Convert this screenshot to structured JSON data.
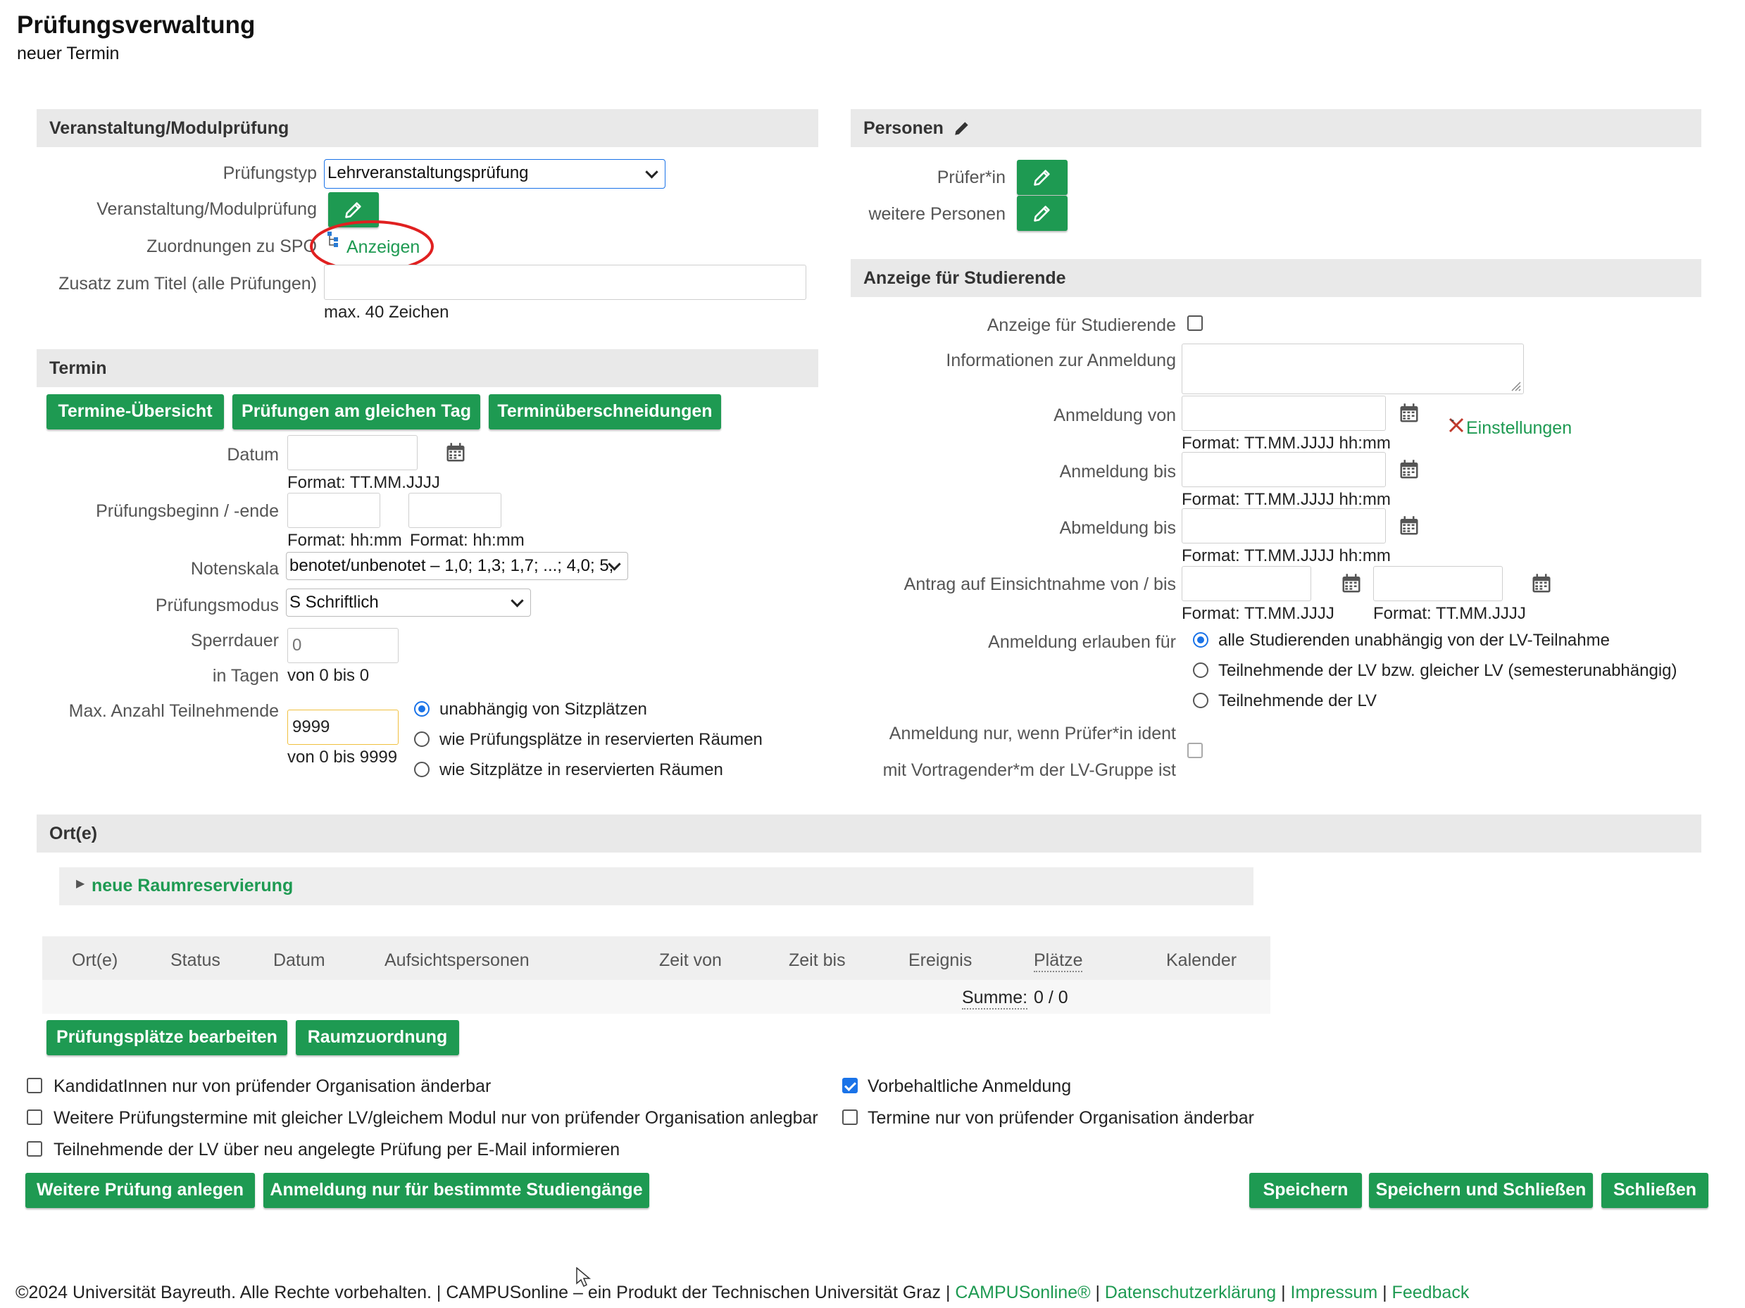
{
  "header": {
    "title": "Prüfungsverwaltung",
    "subtitle": "neuer Termin"
  },
  "veranstaltung": {
    "section_title": "Veranstaltung/Modulprüfung",
    "pruefungstyp_label": "Prüfungstyp",
    "pruefungstyp_value": "Lehrveranstaltungsprüfung",
    "veranstaltung_label": "Veranstaltung/Modulprüfung",
    "zuordnungen_label": "Zuordnungen zu SPO",
    "anzeigen_link": "Anzeigen",
    "zusatz_label": "Zusatz zum Titel (alle Prüfungen)",
    "zusatz_value": "",
    "zusatz_hint": "max. 40 Zeichen"
  },
  "termin": {
    "section_title": "Termin",
    "btn_uebersicht": "Termine-Übersicht",
    "btn_gleicher_tag": "Prüfungen am gleichen Tag",
    "btn_ueberschneidungen": "Terminüberschneidungen",
    "datum_label": "Datum",
    "datum_value": "",
    "datum_format": "Format: TT.MM.JJJJ",
    "beginn_label": "Prüfungsbeginn / -ende",
    "beginn_format": "Format: hh:mm",
    "ende_format": "Format: hh:mm",
    "notenskala_label": "Notenskala",
    "notenskala_value": "benotet/unbenotet – 1,0; 1,3; 1,7; ...; 4,0; 5,",
    "modus_label": "Prüfungsmodus",
    "modus_value": "S Schriftlich",
    "sperrdauer_label": "Sperrdauer",
    "sperrdauer_placeholder": "0",
    "in_tagen_label": "in Tagen",
    "sperrdauer_range": "von 0 bis 0",
    "max_label": "Max. Anzahl Teilnehmende",
    "max_value": "9999",
    "max_range": "von 0 bis 9999",
    "radio_1": "unabhängig von Sitzplätzen",
    "radio_2": "wie Prüfungsplätze in reservierten Räumen",
    "radio_3": "wie Sitzplätze in reservierten Räumen"
  },
  "personen": {
    "section_title": "Personen",
    "pruefer_label": "Prüfer*in",
    "weitere_label": "weitere Personen"
  },
  "anzeige": {
    "section_title": "Anzeige für Studierende",
    "anzeige_label": "Anzeige für Studierende",
    "info_label": "Informationen zur Anmeldung",
    "anmeldung_von_label": "Anmeldung von",
    "anmeldung_bis_label": "Anmeldung bis",
    "abmeldung_bis_label": "Abmeldung bis",
    "datetime_format": "Format: TT.MM.JJJJ hh:mm",
    "einstellungen_link": "Einstellungen",
    "antrag_label": "Antrag auf Einsichtnahme von / bis",
    "date_format": "Format: TT.MM.JJJJ",
    "erlauben_label": "Anmeldung erlauben für",
    "erlauben_1": "alle Studierenden unabhängig von der LV-Teilnahme",
    "erlauben_2": "Teilnehmende der LV bzw. gleicher LV (semesterunabhängig)",
    "erlauben_3": "Teilnehmende der LV",
    "ident_label_1": "Anmeldung nur, wenn Prüfer*in ident",
    "ident_label_2": "mit Vortragender*m der LV-Gruppe ist"
  },
  "orte": {
    "section_title": "Ort(e)",
    "neue_raum": "neue Raumreservierung",
    "columns": [
      "Ort(e)",
      "Status",
      "Datum",
      "Aufsichtspersonen",
      "Zeit von",
      "Zeit bis",
      "Ereignis",
      "Plätze",
      "Kalender"
    ],
    "summe_label": "Summe:",
    "summe_value": "0 / 0",
    "btn_pruefungsplaetze": "Prüfungsplätze bearbeiten",
    "btn_raumzuordnung": "Raumzuordnung"
  },
  "options": {
    "opt_kandidaten": "KandidatInnen nur von prüfender Organisation änderbar",
    "opt_weitere": "Weitere Prüfungstermine mit gleicher LV/gleichem Modul nur von prüfender Organisation anlegbar",
    "opt_email": "Teilnehmende der LV über neu angelegte Prüfung per E-Mail informieren",
    "opt_vorbehalt": "Vorbehaltliche Anmeldung",
    "opt_termine": "Termine nur von prüfender Organisation änderbar"
  },
  "actions": {
    "btn_weitere": "Weitere Prüfung anlegen",
    "btn_anmeldung": "Anmeldung nur für bestimmte Studiengänge",
    "btn_speichern": "Speichern",
    "btn_speichern_schliessen": "Speichern und Schließen",
    "btn_schliessen": "Schließen"
  },
  "footer": {
    "copyright": "©2024 Universität Bayreuth. Alle Rechte vorbehalten. | CAMPUSonline – ein Produkt der Technischen Universität Graz |",
    "link_campus": "CAMPUSonline®",
    "link_datenschutz": "Datenschutzerklärung",
    "link_impressum": "Impressum",
    "link_feedback": "Feedback"
  },
  "colors": {
    "accent": "#1e9a52",
    "highlight_circle": "#e02020",
    "checkbox_blue": "#1a73e8",
    "section_bg": "#e9e9e9"
  }
}
